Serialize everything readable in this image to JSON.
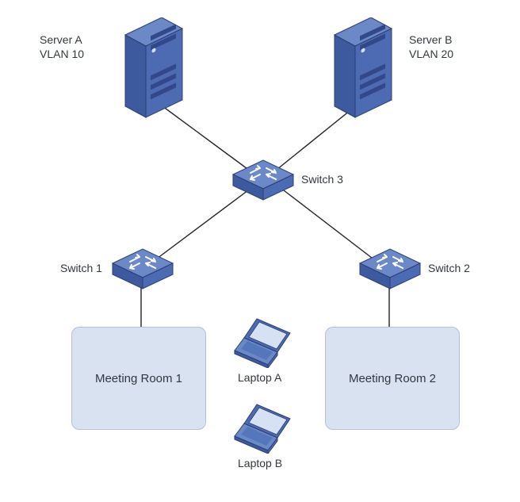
{
  "colors": {
    "server_fill_dark": "#3a5799",
    "server_fill_mid": "#4a6bb0",
    "server_fill_light": "#6b89c7",
    "server_edge": "#2b3f72",
    "switch_fill_top": "#5676bc",
    "switch_fill_left": "#3e5a9e",
    "switch_fill_right": "#4c6bb2",
    "switch_edge": "#2b3f72",
    "laptop_fill_top": "#5676bc",
    "laptop_fill_left": "#3e5a9e",
    "laptop_fill_side": "#4c6bb2",
    "laptop_screen": "#d6e1f3",
    "laptop_edge": "#2b3f72",
    "room_fill": "#d9e2f0",
    "room_border": "#b3c1da",
    "line": "#1f232b"
  },
  "servers": {
    "a": {
      "label_line1": "Server A",
      "label_line2": "VLAN 10"
    },
    "b": {
      "label_line1": "Server B",
      "label_line2": "VLAN 20"
    }
  },
  "switches": {
    "s1": {
      "label": "Switch 1"
    },
    "s2": {
      "label": "Switch 2"
    },
    "s3": {
      "label": "Switch 3"
    }
  },
  "laptops": {
    "a": {
      "label": "Laptop A"
    },
    "b": {
      "label": "Laptop B"
    }
  },
  "rooms": {
    "r1": {
      "label": "Meeting Room 1"
    },
    "r2": {
      "label": "Meeting Room 2"
    }
  }
}
